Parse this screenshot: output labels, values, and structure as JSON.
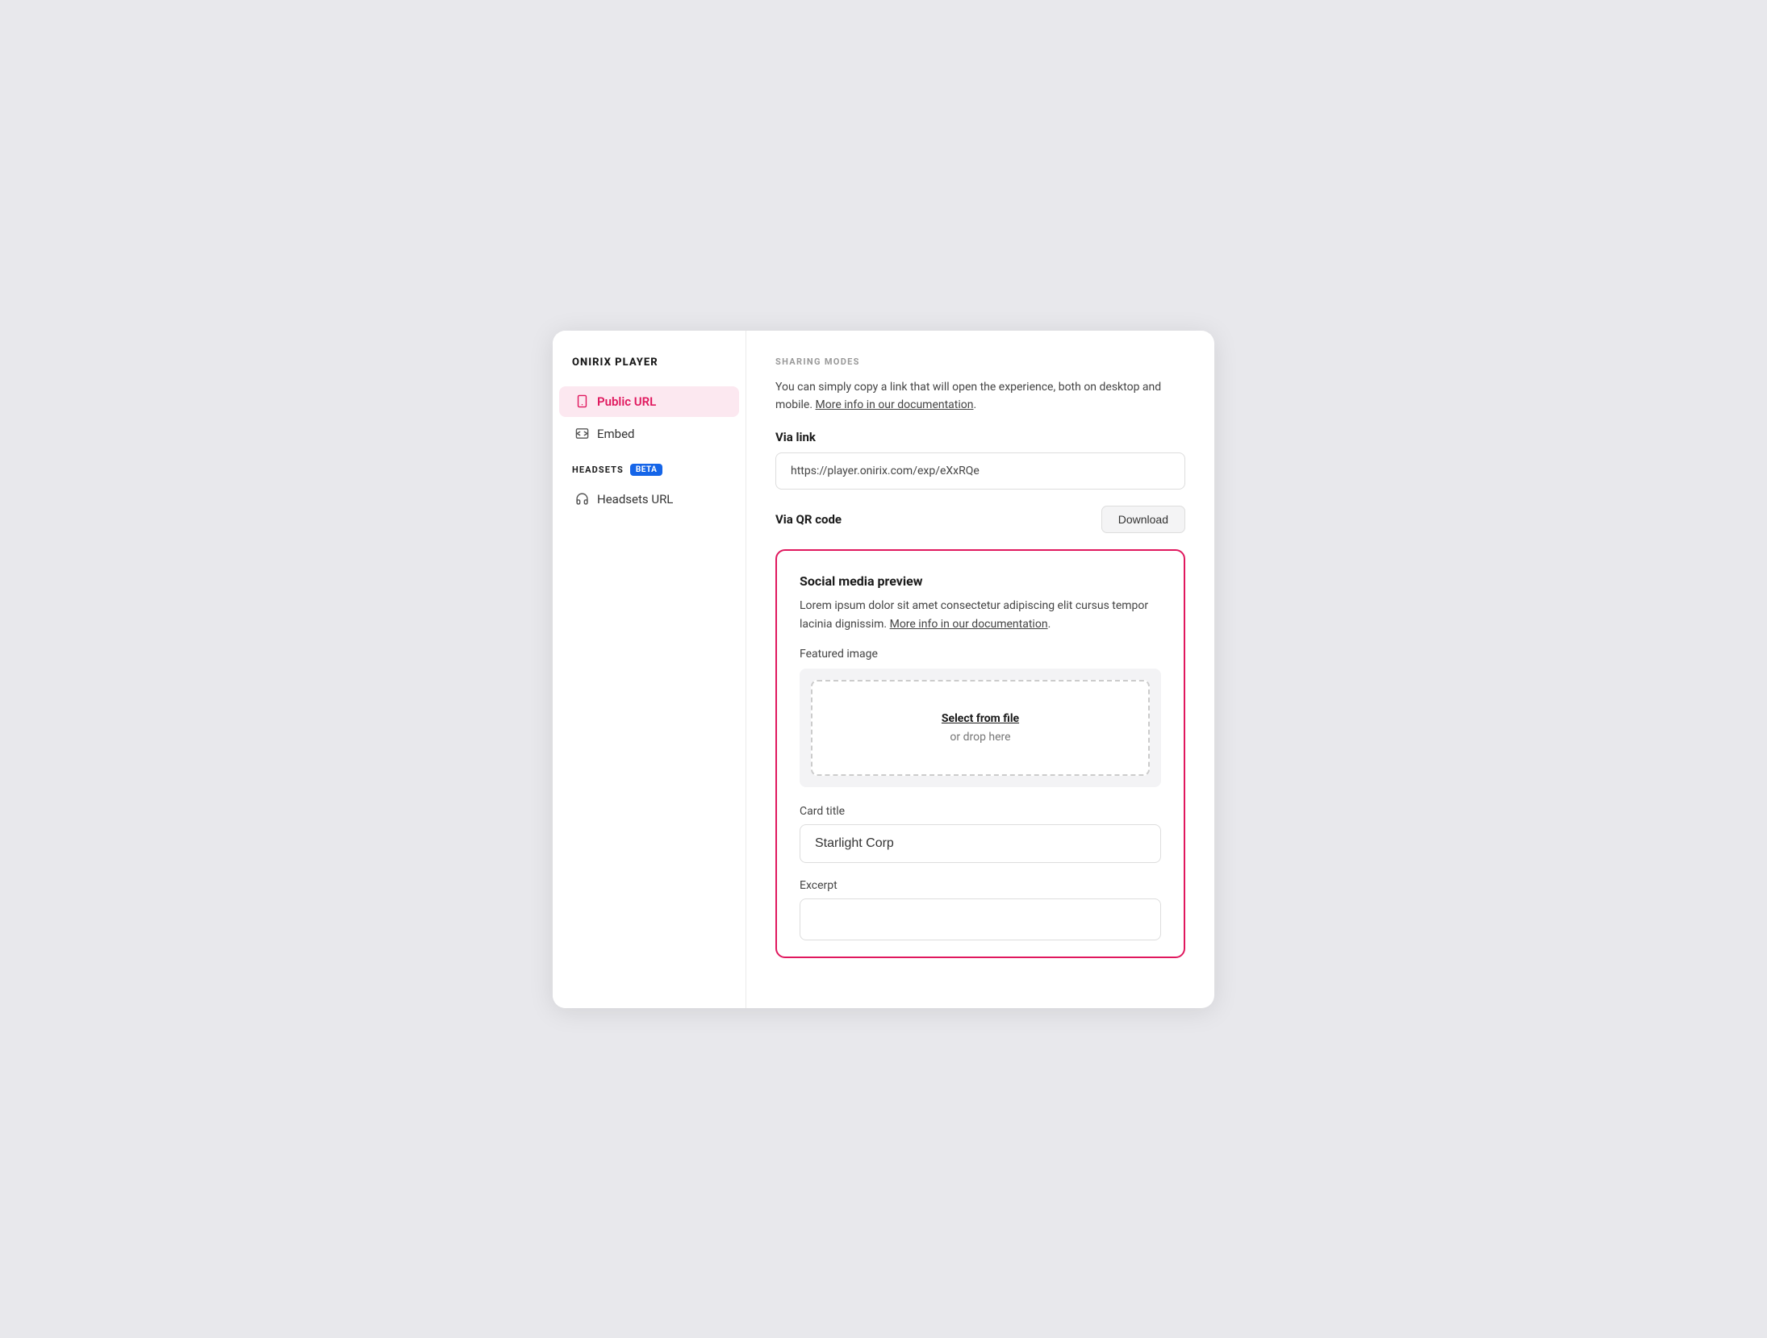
{
  "sidebar": {
    "brand": "ONIRIX PLAYER",
    "sharing_section_label": "",
    "items": [
      {
        "id": "public-url",
        "label": "Public URL",
        "active": true,
        "icon": "mobile"
      },
      {
        "id": "embed",
        "label": "Embed",
        "active": false,
        "icon": "embed"
      }
    ],
    "headsets_label": "HEADSETS",
    "beta_badge": "BETA",
    "headsets_items": [
      {
        "id": "headsets-url",
        "label": "Headsets URL",
        "icon": "headset"
      }
    ]
  },
  "main": {
    "sharing_modes_label": "SHARING MODES",
    "sharing_desc": "You can simply copy a link that will open the experience, both on desktop and mobile.",
    "sharing_doc_link": "More info in our documentation",
    "via_link_label": "Via link",
    "url_value": "https://player.onirix.com/exp/eXxRQe",
    "via_qr_label": "Via QR code",
    "download_btn": "Download",
    "social_preview": {
      "title": "Social media preview",
      "desc": "Lorem ipsum dolor sit amet consectetur adipiscing elit cursus tempor lacinia dignissim.",
      "doc_link": "More info in our documentation",
      "featured_image_label": "Featured image",
      "drop_zone_link": "Select from file",
      "drop_zone_text": "or drop here",
      "card_title_label": "Card title",
      "card_title_value": "Starlight Corp",
      "excerpt_label": "Excerpt"
    }
  }
}
